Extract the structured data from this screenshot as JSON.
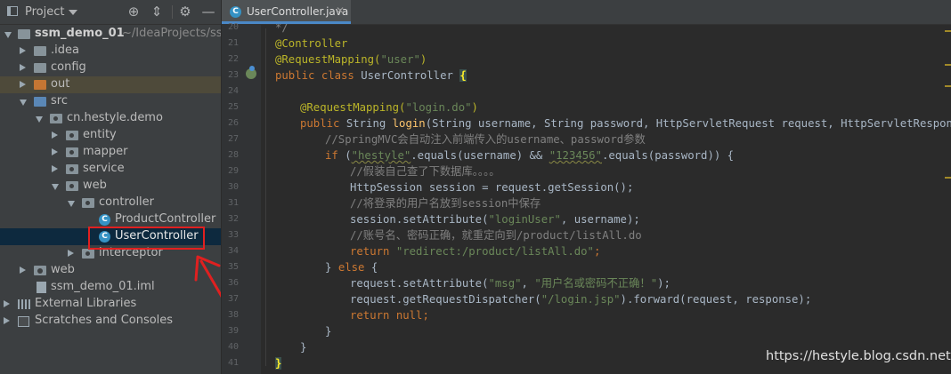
{
  "project_panel": {
    "title": "Project",
    "tree": [
      {
        "label": "ssm_demo_01",
        "note": "~/IdeaProjects/ssm",
        "depth": 0,
        "expanded": true,
        "icon": "module-folder-icon",
        "bold": true
      },
      {
        "label": ".idea",
        "depth": 1,
        "expanded": false,
        "icon": "folder-icon"
      },
      {
        "label": "config",
        "depth": 1,
        "expanded": false,
        "icon": "folder-icon"
      },
      {
        "label": "out",
        "depth": 1,
        "expanded": false,
        "icon": "excluded-folder-icon"
      },
      {
        "label": "src",
        "depth": 1,
        "expanded": true,
        "icon": "source-folder-icon"
      },
      {
        "label": "cn.hestyle.demo",
        "depth": 2,
        "expanded": true,
        "icon": "package-icon"
      },
      {
        "label": "entity",
        "depth": 3,
        "expanded": false,
        "icon": "package-icon"
      },
      {
        "label": "mapper",
        "depth": 3,
        "expanded": false,
        "icon": "package-icon"
      },
      {
        "label": "service",
        "depth": 3,
        "expanded": false,
        "icon": "package-icon"
      },
      {
        "label": "web",
        "depth": 3,
        "expanded": true,
        "icon": "package-icon"
      },
      {
        "label": "controller",
        "depth": 4,
        "expanded": true,
        "icon": "package-icon"
      },
      {
        "label": "ProductController",
        "depth": 5,
        "icon": "java-class-icon"
      },
      {
        "label": "UserController",
        "depth": 5,
        "icon": "java-class-icon",
        "selected": true
      },
      {
        "label": "interceptor",
        "depth": 4,
        "expanded": false,
        "icon": "package-icon"
      },
      {
        "label": "web",
        "depth": 1,
        "expanded": false,
        "icon": "web-folder-icon"
      },
      {
        "label": "ssm_demo_01.iml",
        "depth": 1,
        "icon": "iml-file-icon"
      },
      {
        "label": "External Libraries",
        "depth": 0,
        "expanded": false,
        "icon": "libraries-icon"
      },
      {
        "label": "Scratches and Consoles",
        "depth": 0,
        "expanded": false,
        "icon": "scratches-icon"
      }
    ]
  },
  "editor": {
    "tab_label": "UserController.java",
    "line_numbers": [
      "20",
      "21",
      "22",
      "23",
      "24",
      "25",
      "26",
      "27",
      "28",
      "29",
      "30",
      "31",
      "32",
      "33",
      "34",
      "35",
      "36",
      "37",
      "38",
      "39",
      "40",
      "41"
    ]
  },
  "code": {
    "l20": "*/",
    "l21_annot": "@Controller",
    "l22_annot": "@RequestMapping(",
    "l22_str": "\"user\"",
    "l22_end": ")",
    "l23_kw": "public class ",
    "l23_name": "UserController ",
    "l23_brace": "{",
    "l25_annot": "@RequestMapping(",
    "l25_str": "\"login.do\"",
    "l25_end": ")",
    "l26_kw": "public ",
    "l26_type": "String ",
    "l26_fn": "login",
    "l26_params": "(String username, String password, HttpServletRequest request, HttpServletResponse res",
    "l27_cmt": "//SpringMVC会自动注入前端传入的username、password参数",
    "l28_kw": "if ",
    "l28_p1": "(",
    "l28_str1": "\"hestyle\"",
    "l28_p2": ".equals(username) && ",
    "l28_str2": "\"123456\"",
    "l28_p3": ".equals(password)) {",
    "l29_cmt": "//假装自己查了下数据库。。。。",
    "l30": "HttpSession session = request.getSession();",
    "l31_cmt": "//将登录的用户名放到session中保存",
    "l32_a": "session.setAttribute(",
    "l32_str": "\"loginUser\"",
    "l32_b": ", username);",
    "l33_cmt": "//账号名、密码正确，就重定向到/product/listAll.do",
    "l34_kw": "return ",
    "l34_str": "\"redirect:/product/listAll.do\"",
    "l34_end": ";",
    "l35_a": "} ",
    "l35_kw": "else ",
    "l35_b": "{",
    "l36_a": "request.setAttribute(",
    "l36_str1": "\"msg\"",
    "l36_b": ", ",
    "l36_str2": "\"用户名或密码不正确！\"",
    "l36_c": ");",
    "l37_a": "request.getRequestDispatcher(",
    "l37_str": "\"/login.jsp\"",
    "l37_b": ").forward(request, response);",
    "l38_kw": "return null",
    "l38_end": ";",
    "l39": "}",
    "l40": "}",
    "l41": "}"
  },
  "watermark": "https://hestyle.blog.csdn.net",
  "colors": {
    "panel_bg": "#3c3f41",
    "editor_bg": "#2b2b2b",
    "keyword": "#cc7832",
    "string": "#6a8759",
    "annotation": "#bbb529",
    "comment": "#808080",
    "highlight_box": "#e02020"
  }
}
